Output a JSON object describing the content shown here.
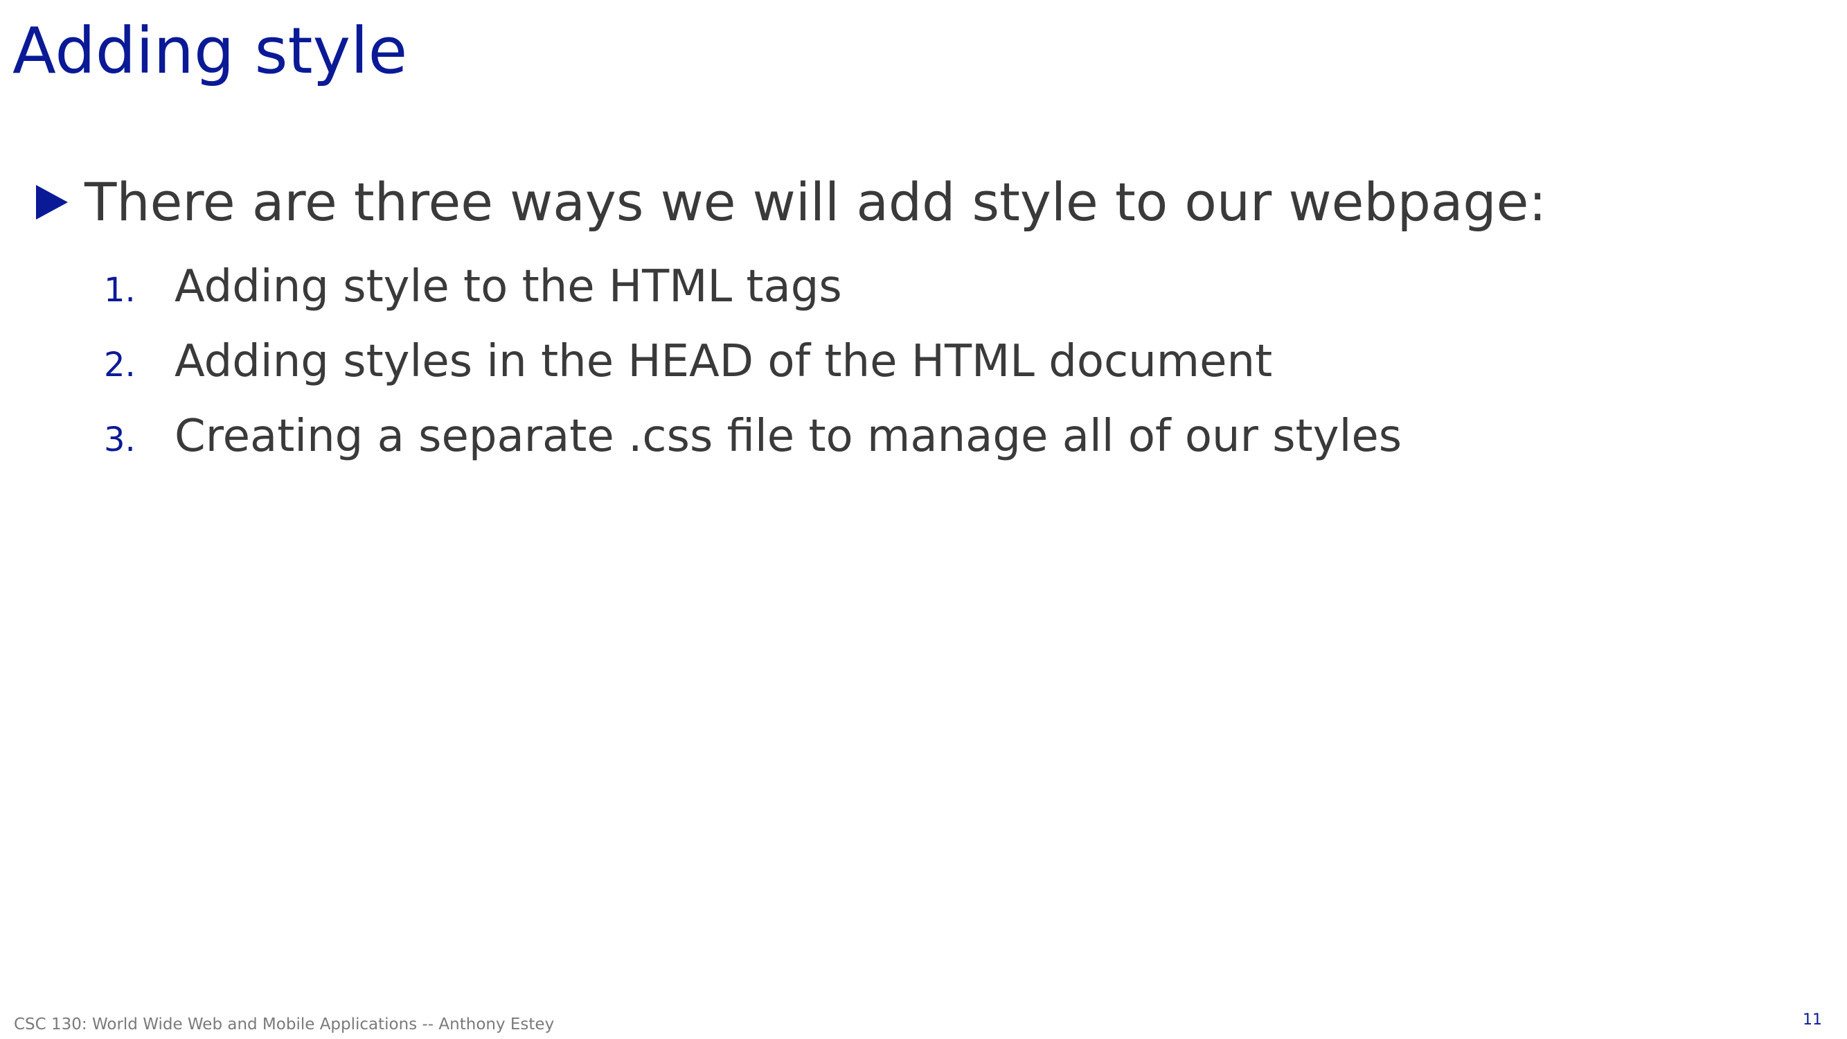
{
  "slide": {
    "title": "Adding style",
    "bullet": {
      "icon": "triangle-right-icon",
      "text": "There are three ways we will add style to our webpage:"
    },
    "items": [
      {
        "number": "1.",
        "text": "Adding style to the HTML tags"
      },
      {
        "number": "2.",
        "text": "Adding styles in the HEAD of the HTML document"
      },
      {
        "number": "3.",
        "text": "Creating a separate .css file to manage all of our styles"
      }
    ],
    "footer": "CSC 130: World Wide Web and Mobile Applications -- Anthony Estey",
    "page_number": "11"
  },
  "colors": {
    "accent": "#0a1a96",
    "body_text": "#3a3a3a",
    "footer_text": "#7a7a7a",
    "background": "#ffffff"
  }
}
